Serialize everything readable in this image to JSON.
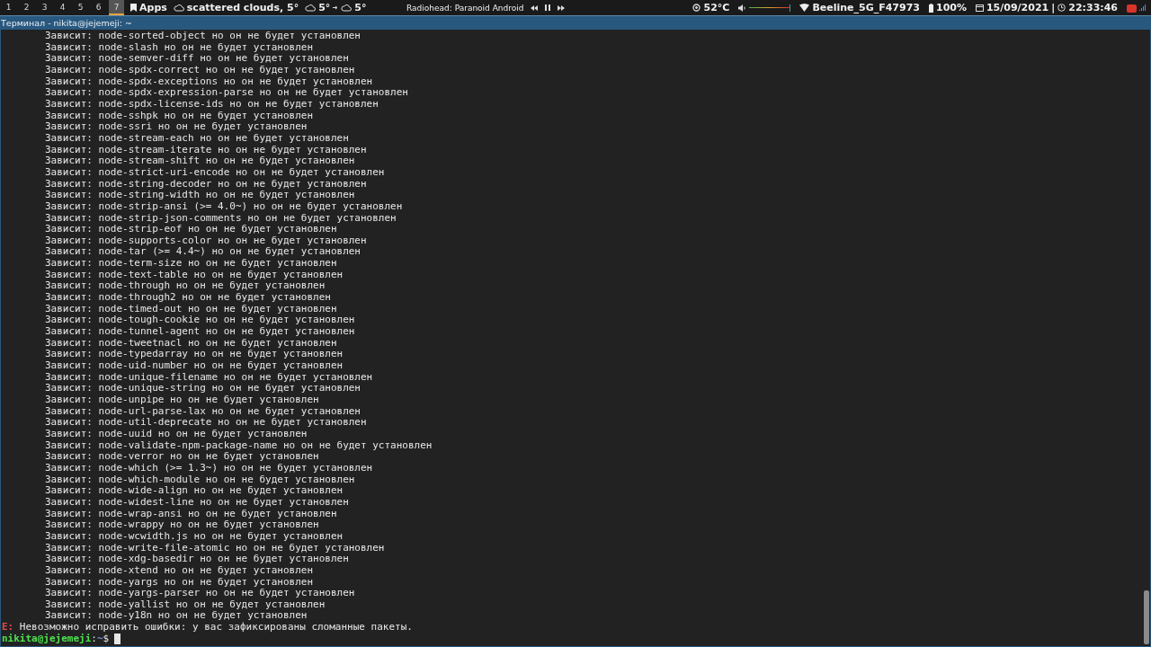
{
  "top_bar": {
    "workspaces": [
      {
        "label": "1",
        "selected": false
      },
      {
        "label": "2",
        "selected": false
      },
      {
        "label": "3",
        "selected": false
      },
      {
        "label": "4",
        "selected": false
      },
      {
        "label": "5",
        "selected": false
      },
      {
        "label": "6",
        "selected": false
      },
      {
        "label": "7",
        "selected": true
      }
    ],
    "apps_label": "Apps",
    "weather": "scattered clouds, 5°",
    "forecast_now": "5°",
    "forecast_next": "5°",
    "now_playing": "Radiohead: Paranoid Android",
    "temperature": "52°C",
    "volume": {
      "level": 1.0
    },
    "wifi": "Beeline_5G_F47973",
    "battery": "100%",
    "date": "15/09/2021",
    "separator": "|",
    "time": "22:33:46"
  },
  "window": {
    "title": "Терминал - nikita@jejemeji: ~"
  },
  "terminal": {
    "lines": [
      "Зависит: node-sorted-object но он не будет установлен",
      "Зависит: node-slash но он не будет установлен",
      "Зависит: node-semver-diff но он не будет установлен",
      "Зависит: node-spdx-correct но он не будет установлен",
      "Зависит: node-spdx-exceptions но он не будет установлен",
      "Зависит: node-spdx-expression-parse но он не будет установлен",
      "Зависит: node-spdx-license-ids но он не будет установлен",
      "Зависит: node-sshpk но он не будет установлен",
      "Зависит: node-ssri но он не будет установлен",
      "Зависит: node-stream-each но он не будет установлен",
      "Зависит: node-stream-iterate но он не будет установлен",
      "Зависит: node-stream-shift но он не будет установлен",
      "Зависит: node-strict-uri-encode но он не будет установлен",
      "Зависит: node-string-decoder но он не будет установлен",
      "Зависит: node-string-width но он не будет установлен",
      "Зависит: node-strip-ansi (>= 4.0~) но он не будет установлен",
      "Зависит: node-strip-json-comments но он не будет установлен",
      "Зависит: node-strip-eof но он не будет установлен",
      "Зависит: node-supports-color но он не будет установлен",
      "Зависит: node-tar (>= 4.4~) но он не будет установлен",
      "Зависит: node-term-size но он не будет установлен",
      "Зависит: node-text-table но он не будет установлен",
      "Зависит: node-through но он не будет установлен",
      "Зависит: node-through2 но он не будет установлен",
      "Зависит: node-timed-out но он не будет установлен",
      "Зависит: node-tough-cookie но он не будет установлен",
      "Зависит: node-tunnel-agent но он не будет установлен",
      "Зависит: node-tweetnacl но он не будет установлен",
      "Зависит: node-typedarray но он не будет установлен",
      "Зависит: node-uid-number но он не будет установлен",
      "Зависит: node-unique-filename но он не будет установлен",
      "Зависит: node-unique-string но он не будет установлен",
      "Зависит: node-unpipe но он не будет установлен",
      "Зависит: node-url-parse-lax но он не будет установлен",
      "Зависит: node-util-deprecate но он не будет установлен",
      "Зависит: node-uuid но он не будет установлен",
      "Зависит: node-validate-npm-package-name но он не будет установлен",
      "Зависит: node-verror но он не будет установлен",
      "Зависит: node-which (>= 1.3~) но он не будет установлен",
      "Зависит: node-which-module но он не будет установлен",
      "Зависит: node-wide-align но он не будет установлен",
      "Зависит: node-widest-line но он не будет установлен",
      "Зависит: node-wrap-ansi но он не будет установлен",
      "Зависит: node-wrappy но он не будет установлен",
      "Зависит: node-wcwidth.js но он не будет установлен",
      "Зависит: node-write-file-atomic но он не будет установлен",
      "Зависит: node-xdg-basedir но он не будет установлен",
      "Зависит: node-xtend но он не будет установлен",
      "Зависит: node-yargs но он не будет установлен",
      "Зависит: node-yargs-parser но он не будет установлен",
      "Зависит: node-yallist но он не будет установлен",
      "Зависит: node-y18n но он не будет установлен"
    ],
    "error": {
      "prefix": "E:",
      "message": "Невозможно исправить ошибки: у вас зафиксированы сломанные пакеты."
    },
    "prompt": {
      "user_host": "nikita@jejemeji",
      "colon": ":",
      "path": "~",
      "symbol": "$"
    }
  }
}
